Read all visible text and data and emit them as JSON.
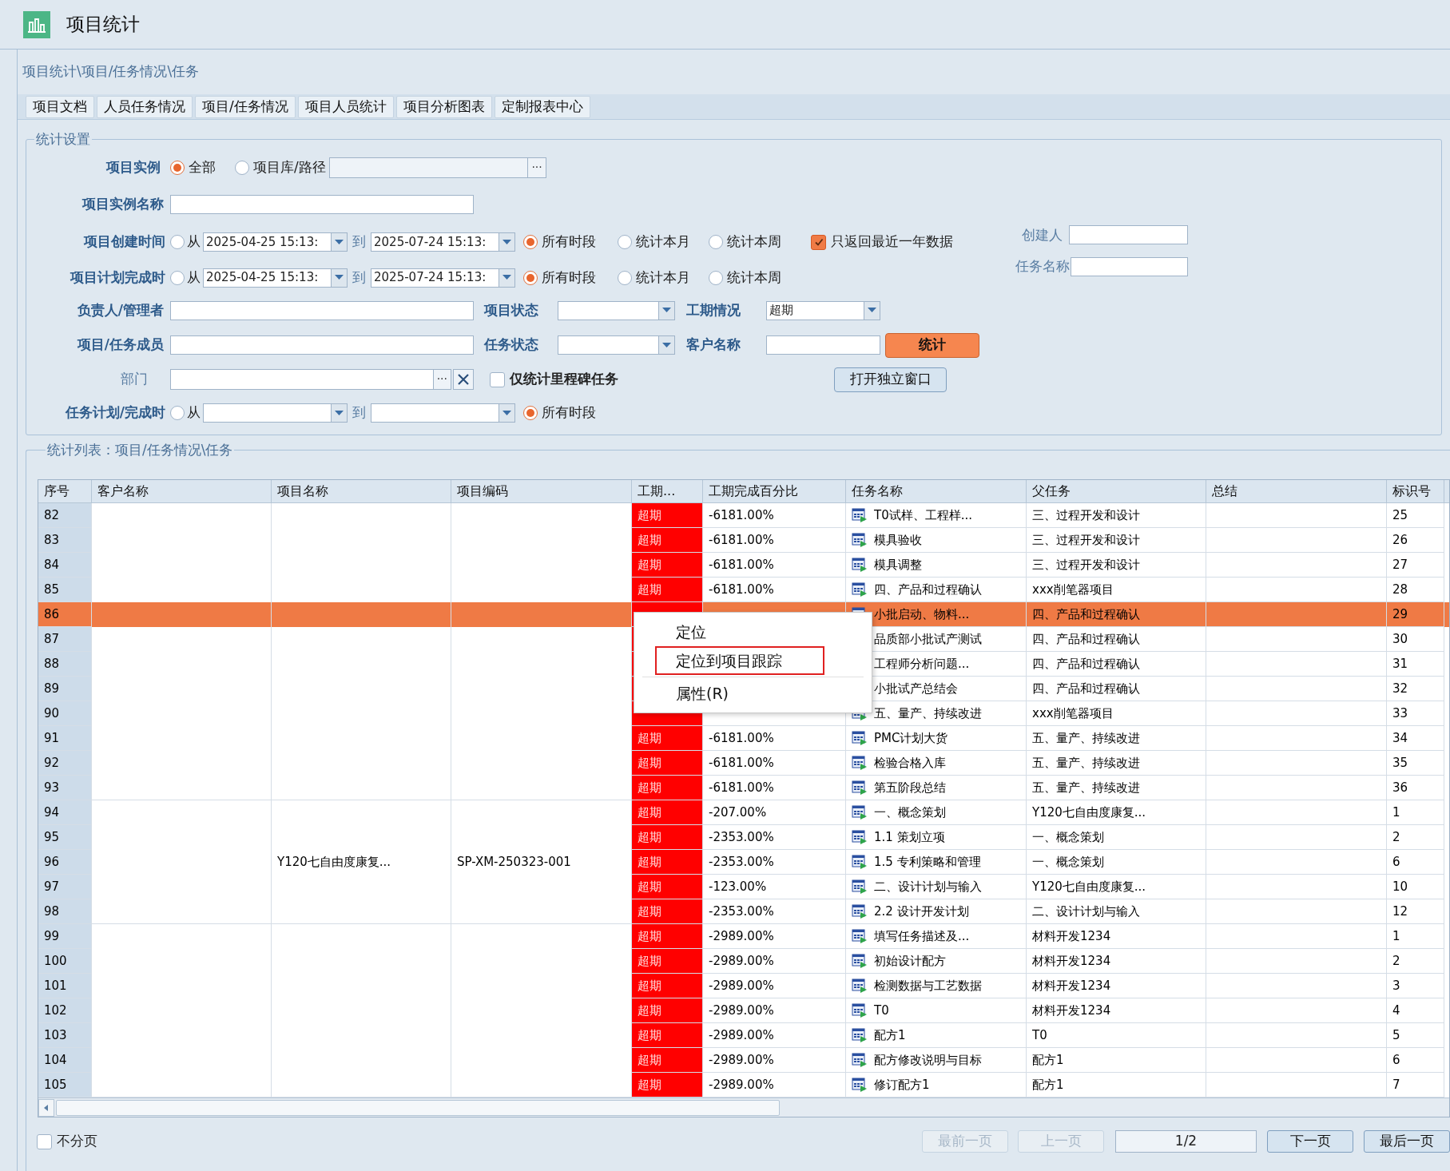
{
  "window": {
    "title": "项目统计"
  },
  "breadcrumb": "项目统计\\项目/任务情况\\任务",
  "tabs": [
    {
      "label": "项目文档"
    },
    {
      "label": "人员任务情况"
    },
    {
      "label": "项目/任务情况"
    },
    {
      "label": "项目人员统计"
    },
    {
      "label": "项目分析图表"
    },
    {
      "label": "定制报表中心"
    }
  ],
  "settings": {
    "legend": "统计设置",
    "instance": {
      "label": "项目实例",
      "options": [
        {
          "label": "全部",
          "selected": true
        },
        {
          "label": "项目库/路径",
          "selected": false
        }
      ],
      "browse": "···"
    },
    "instance_name": {
      "label": "项目实例名称"
    },
    "created": {
      "label": "项目创建时间",
      "range_selected": false,
      "from_label": "从",
      "from": "2025-04-25 15:13:",
      "to_label": "到",
      "to": "2025-07-24 15:13:",
      "periods": [
        {
          "label": "所有时段",
          "selected": true
        },
        {
          "label": "统计本月",
          "selected": false
        },
        {
          "label": "统计本周",
          "selected": false
        }
      ]
    },
    "recent_year": {
      "label": "只返回最近一年数据",
      "checked": true
    },
    "planned": {
      "label": "项目计划完成时",
      "range_selected": false,
      "from_label": "从",
      "from": "2025-04-25 15:13:",
      "to_label": "到",
      "to": "2025-07-24 15:13:",
      "periods": [
        {
          "label": "所有时段",
          "selected": true
        },
        {
          "label": "统计本月",
          "selected": false
        },
        {
          "label": "统计本周",
          "selected": false
        }
      ]
    },
    "manager": {
      "label": "负责人/管理者"
    },
    "project_status": {
      "label": "项目状态"
    },
    "schedule": {
      "label": "工期情况",
      "value": "超期"
    },
    "member": {
      "label": "项目/任务成员"
    },
    "task_status": {
      "label": "任务状态"
    },
    "customer": {
      "label": "客户名称"
    },
    "run_button": "统计",
    "department": {
      "label": "部门",
      "browse": "···"
    },
    "milestone_only": {
      "label": "仅统计里程碑任务",
      "checked": false
    },
    "open_window_button": "打开独立窗口",
    "task_time": {
      "label": "任务计划/完成时",
      "range_selected": false,
      "from_label": "从",
      "to_label": "到",
      "periods": [
        {
          "label": "所有时段",
          "selected": true
        }
      ]
    },
    "creator": {
      "label": "创建人"
    },
    "task_name": {
      "label": "任务名称"
    }
  },
  "list": {
    "legend": "统计列表：项目/任务情况\\任务",
    "columns": [
      "序号",
      "客户名称",
      "项目名称",
      "项目编码",
      "工期...",
      "工期完成百分比",
      "任务名称",
      "父任务",
      "总结",
      "标识号"
    ],
    "groups": [
      {
        "rows": [
          {
            "no": "82",
            "selected": false,
            "overdue": true,
            "status": "超期",
            "percent": "-6181.00%",
            "icon": true,
            "task": "T0试样、工程样...",
            "parent": "三、过程开发和设计",
            "id": "25"
          },
          {
            "no": "83",
            "selected": false,
            "overdue": true,
            "status": "超期",
            "percent": "-6181.00%",
            "icon": true,
            "task": "模具验收",
            "parent": "三、过程开发和设计",
            "id": "26"
          },
          {
            "no": "84",
            "selected": false,
            "overdue": true,
            "status": "超期",
            "percent": "-6181.00%",
            "icon": true,
            "task": "模具调整",
            "parent": "三、过程开发和设计",
            "id": "27"
          },
          {
            "no": "85",
            "selected": false,
            "overdue": true,
            "status": "超期",
            "percent": "-6181.00%",
            "icon": true,
            "task": "四、产品和过程确认",
            "parent": "xxx削笔器项目",
            "id": "28"
          },
          {
            "no": "86",
            "selected": true,
            "overdue": true,
            "icon": true,
            "task": "小批启动、物料...",
            "parent": "四、产品和过程确认",
            "id": "29"
          },
          {
            "no": "87",
            "selected": false,
            "overdue": true,
            "icon": false,
            "task": "品质部小批试产测试",
            "parent": "四、产品和过程确认",
            "id": "30"
          },
          {
            "no": "88",
            "selected": false,
            "overdue": true,
            "icon": false,
            "task": "工程师分析问题...",
            "parent": "四、产品和过程确认",
            "id": "31"
          },
          {
            "no": "89",
            "selected": false,
            "overdue": true,
            "icon": false,
            "task": "小批试产总结会",
            "parent": "四、产品和过程确认",
            "id": "32"
          },
          {
            "no": "90",
            "selected": false,
            "overdue": true,
            "icon": true,
            "task": "五、量产、持续改进",
            "parent": "xxx削笔器项目",
            "id": "33"
          },
          {
            "no": "91",
            "selected": false,
            "overdue": true,
            "status": "超期",
            "percent": "-6181.00%",
            "icon": true,
            "task": "PMC计划大货",
            "parent": "五、量产、持续改进",
            "id": "34"
          },
          {
            "no": "92",
            "selected": false,
            "overdue": true,
            "status": "超期",
            "percent": "-6181.00%",
            "icon": true,
            "task": "检验合格入库",
            "parent": "五、量产、持续改进",
            "id": "35"
          },
          {
            "no": "93",
            "selected": false,
            "overdue": true,
            "status": "超期",
            "percent": "-6181.00%",
            "icon": true,
            "task": "第五阶段总结",
            "parent": "五、量产、持续改进",
            "id": "36"
          }
        ]
      },
      {
        "project_name": "Y120七自由度康复...",
        "project_code": "SP-XM-250323-001",
        "rows": [
          {
            "no": "94",
            "selected": false,
            "overdue": true,
            "status": "超期",
            "percent": "-207.00%",
            "icon": true,
            "task": "一、概念策划",
            "parent": "Y120七自由度康复...",
            "id": "1"
          },
          {
            "no": "95",
            "selected": false,
            "overdue": true,
            "status": "超期",
            "percent": "-2353.00%",
            "icon": true,
            "task": "1.1 策划立项",
            "parent": "一、概念策划",
            "id": "2"
          },
          {
            "no": "96",
            "selected": false,
            "overdue": true,
            "status": "超期",
            "percent": "-2353.00%",
            "icon": true,
            "task": "1.5 专利策略和管理",
            "parent": "一、概念策划",
            "id": "6"
          },
          {
            "no": "97",
            "selected": false,
            "overdue": true,
            "status": "超期",
            "percent": "-123.00%",
            "icon": true,
            "task": "二、设计计划与输入",
            "parent": "Y120七自由度康复...",
            "id": "10"
          },
          {
            "no": "98",
            "selected": false,
            "overdue": true,
            "status": "超期",
            "percent": "-2353.00%",
            "icon": true,
            "task": "2.2 设计开发计划",
            "parent": "二、设计计划与输入",
            "id": "12"
          }
        ]
      },
      {
        "rows": [
          {
            "no": "99",
            "selected": false,
            "overdue": true,
            "status": "超期",
            "percent": "-2989.00%",
            "icon": true,
            "task": "填写任务描述及...",
            "parent": "材料开发1234",
            "id": "1"
          },
          {
            "no": "100",
            "selected": false,
            "overdue": true,
            "status": "超期",
            "percent": "-2989.00%",
            "icon": true,
            "task": "初始设计配方",
            "parent": "材料开发1234",
            "id": "2"
          },
          {
            "no": "101",
            "selected": false,
            "overdue": true,
            "status": "超期",
            "percent": "-2989.00%",
            "icon": true,
            "task": "检测数据与工艺数据",
            "parent": "材料开发1234",
            "id": "3"
          },
          {
            "no": "102",
            "selected": false,
            "overdue": true,
            "status": "超期",
            "percent": "-2989.00%",
            "icon": true,
            "task": "T0",
            "parent": "材料开发1234",
            "id": "4"
          },
          {
            "no": "103",
            "selected": false,
            "overdue": true,
            "status": "超期",
            "percent": "-2989.00%",
            "icon": true,
            "task": "配方1",
            "parent": "T0",
            "id": "5"
          },
          {
            "no": "104",
            "selected": false,
            "overdue": true,
            "status": "超期",
            "percent": "-2989.00%",
            "icon": true,
            "task": "配方修改说明与目标",
            "parent": "配方1",
            "id": "6"
          },
          {
            "no": "105",
            "selected": false,
            "overdue": true,
            "status": "超期",
            "percent": "-2989.00%",
            "icon": true,
            "task": "修订配方1",
            "parent": "配方1",
            "id": "7"
          }
        ]
      }
    ],
    "context_menu": {
      "items": [
        {
          "label": "定位",
          "selected": false
        },
        {
          "label": "定位到项目跟踪",
          "selected": true
        },
        {
          "label": "属性(R)",
          "selected": false
        }
      ]
    }
  },
  "footer": {
    "no_paging": {
      "label": "不分页",
      "checked": false
    },
    "buttons": [
      {
        "label": "最前一页",
        "disabled": true
      },
      {
        "label": "上一页",
        "disabled": true
      }
    ],
    "page": "1/2",
    "nav_buttons": [
      {
        "label": "下一页",
        "disabled": false
      },
      {
        "label": "最后一页",
        "disabled": false
      }
    ]
  }
}
